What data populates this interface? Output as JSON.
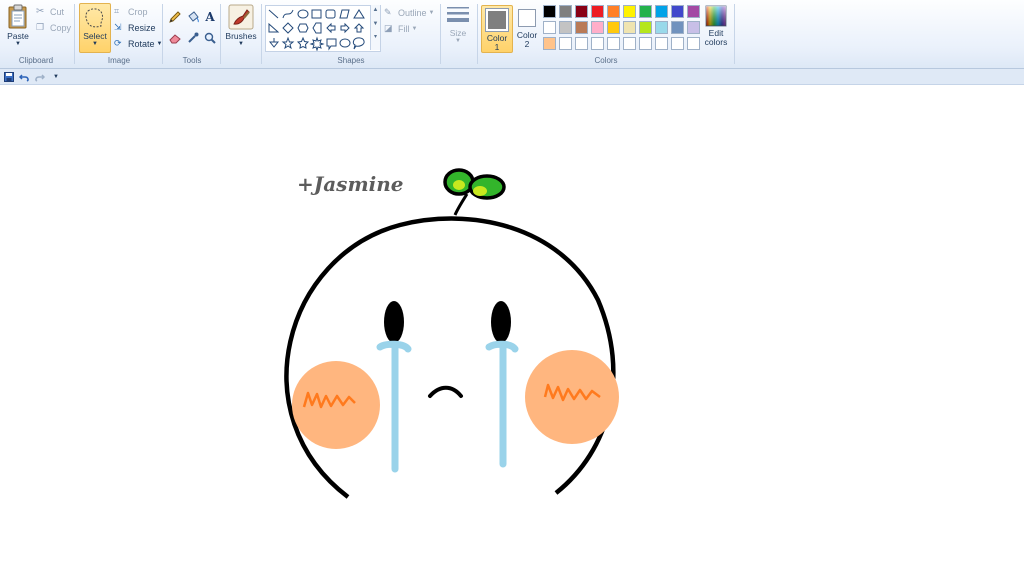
{
  "clipboard": {
    "paste": "Paste",
    "cut": "Cut",
    "copy": "Copy",
    "group": "Clipboard"
  },
  "image": {
    "select": "Select",
    "crop": "Crop",
    "resize": "Resize",
    "rotate": "Rotate",
    "group": "Image"
  },
  "tools": {
    "group": "Tools"
  },
  "brushes": {
    "label": "Brushes"
  },
  "shapes": {
    "outline": "Outline",
    "fill": "Fill",
    "group": "Shapes"
  },
  "size": {
    "label": "Size"
  },
  "colors": {
    "color1": "Color 1",
    "color2": "Color 2",
    "color1_value": "#7f7f7f",
    "color2_value": "#ffffff",
    "edit": "Edit colors",
    "group": "Colors",
    "palette_row1": [
      "#000000",
      "#7f7f7f",
      "#880015",
      "#ed1c24",
      "#ff7f27",
      "#fff200",
      "#22b14c",
      "#00a2e8",
      "#3f48cc",
      "#a349a4"
    ],
    "palette_row2": [
      "#ffffff",
      "#c3c3c3",
      "#b97a57",
      "#ffaec9",
      "#ffc90e",
      "#efe4b0",
      "#b5e61d",
      "#99d9ea",
      "#7092be",
      "#c8bfe7"
    ],
    "palette_row3": [
      "#ffc38a",
      "#ffffff",
      "#ffffff",
      "#ffffff",
      "#ffffff",
      "#ffffff",
      "#ffffff",
      "#ffffff",
      "#ffffff",
      "#ffffff"
    ]
  },
  "drawing": {
    "signature": "+Jasmine",
    "outline_color": "#000000",
    "leaf_color": "#33b52b",
    "leaf_highlight": "#c8e81f",
    "tear_color": "#9ad3ea",
    "cheek_color": "#ffb67f",
    "blush_color": "#ff7a1e"
  }
}
